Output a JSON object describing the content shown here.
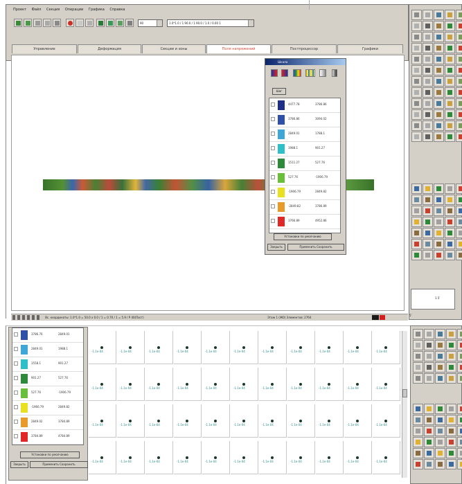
{
  "menu": [
    "Проект",
    "Файл",
    "Секция",
    "Операции",
    "Графика",
    "Справка"
  ],
  "toolbar": {
    "zoom_value": "90",
    "coord_combo": "1.0*1.0 / 1 90.0 / 1 90.0 / 1.0 / 0.00 1"
  },
  "tabs": [
    {
      "label": "Управление"
    },
    {
      "label": "Деформация"
    },
    {
      "label": "Секции и зоны"
    },
    {
      "label": "Поля напряжений"
    },
    {
      "label": "Постпроцессор"
    },
    {
      "label": "Графики"
    }
  ],
  "palette": {
    "title": "Шкала",
    "level_button": "Шаг",
    "rows": [
      {
        "color": "#1e2f8a",
        "v1": "4477.78",
        "v2": "3786.86"
      },
      {
        "color": "#2f4fa8",
        "v1": "3786.86",
        "v2": "3094.02"
      },
      {
        "color": "#3fa6d8",
        "v1": "2849.01",
        "v2": "1788.1"
      },
      {
        "color": "#2fbfc8",
        "v1": "1988.1",
        "v2": "901.27"
      },
      {
        "color": "#2e8a3a",
        "v1": "1511.27",
        "v2": "527.76"
      },
      {
        "color": "#6abf3a",
        "v1": "527.76",
        "v2": "-1906.79"
      },
      {
        "color": "#e8e020",
        "v1": "-1906.79",
        "v2": "2849.82"
      },
      {
        "color": "#e89a2a",
        "v1": "-2849.82",
        "v2": "3786.89"
      },
      {
        "color": "#e02828",
        "v1": "3766.89",
        "v2": "4952.86"
      }
    ],
    "apply_button": "Установки по умолчанию",
    "close_button": "Закрыть",
    "save_button": "Применить Сохранить"
  },
  "status": {
    "left": "Вс. координаты: 1.0*1.0 = 50.0 x 0.0 / 1 = 0.70 / 1 = 5.9 / Р 40(Пост)",
    "middle": "Этаж 1 (Ж0) Элементов: 2764"
  },
  "bottom_palette": {
    "rows": [
      {
        "color": "#2f4fa8",
        "v1": "3786.76",
        "v2": "2849.01"
      },
      {
        "color": "#3fa6d8",
        "v1": "2849.01",
        "v2": "1988.1"
      },
      {
        "color": "#2fbfc8",
        "v1": "1558.1",
        "v2": "901.27"
      },
      {
        "color": "#2e8a3a",
        "v1": "901.27",
        "v2": "527.76"
      },
      {
        "color": "#6abf3a",
        "v1": "527.76",
        "v2": "-1906.79"
      },
      {
        "color": "#e8e020",
        "v1": "-1966.79",
        "v2": "2849.82"
      },
      {
        "color": "#e89a2a",
        "v1": "2849.02",
        "v2": "3784.89"
      },
      {
        "color": "#e02828",
        "v1": "3784.89",
        "v2": "4784.89"
      }
    ],
    "apply_button": "Установки по умолчанию",
    "close_button": "Закрыть",
    "save_button": "Применить Сохранить"
  },
  "grid_labels": [
    [
      "-1.1е-04",
      "-1.1е-04",
      "-1.1е-04",
      "-1.1е-04",
      "-1.1е-04",
      "-1.1е-04",
      "-1.1е-04",
      "-1.1е-04",
      "-1.1е-04",
      "-1.1е-04",
      "-1.1е-04"
    ],
    [
      "-1.1е-04",
      "-1.1е-04",
      "-1.1е-04",
      "-1.1е-04",
      "-1.1е-04",
      "-1.1е-04",
      "-1.1е-04",
      "-1.1е-04",
      "-1.1е-04",
      "-1.1е-04",
      "-1.1е-04"
    ],
    [
      "-1.1е-04",
      "-1.1е-04",
      "-1.1е-04",
      "-1.1е-04",
      "-1.1е-04",
      "-1.1е-04",
      "-1.1е-04",
      "-1.1е-04",
      "-1.1е-04",
      "-1.1е-04",
      "-1.1е-04"
    ],
    [
      "-1.1е-04",
      "-1.1е-04",
      "-1.1е-04",
      "-1.1е-04",
      "-1.1е-04",
      "-1.1е-04",
      "-1.1е-04",
      "-1.1е-04",
      "-1.1е-04",
      "-1.1е-04",
      "-1.1е-04"
    ]
  ],
  "right_panel": {
    "value_box": "1.5ʹ",
    "bottom_label": "5ʹ"
  }
}
